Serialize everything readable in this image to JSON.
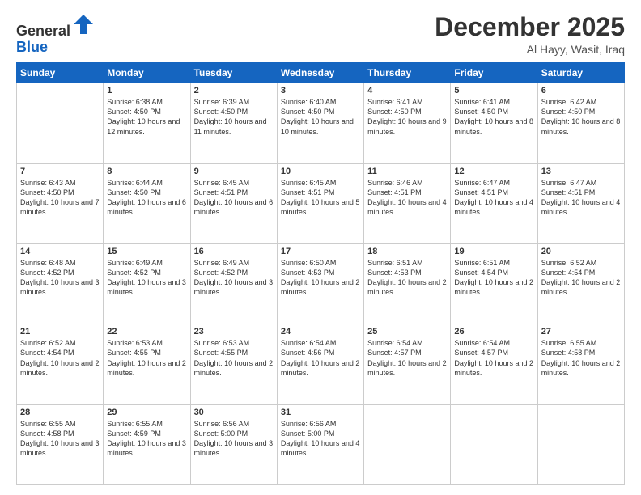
{
  "header": {
    "logo_general": "General",
    "logo_blue": "Blue",
    "month_title": "December 2025",
    "subtitle": "Al Hayy, Wasit, Iraq"
  },
  "days_of_week": [
    "Sunday",
    "Monday",
    "Tuesday",
    "Wednesday",
    "Thursday",
    "Friday",
    "Saturday"
  ],
  "weeks": [
    [
      {
        "day": "",
        "sunrise": "",
        "sunset": "",
        "daylight": ""
      },
      {
        "day": "1",
        "sunrise": "Sunrise: 6:38 AM",
        "sunset": "Sunset: 4:50 PM",
        "daylight": "Daylight: 10 hours and 12 minutes."
      },
      {
        "day": "2",
        "sunrise": "Sunrise: 6:39 AM",
        "sunset": "Sunset: 4:50 PM",
        "daylight": "Daylight: 10 hours and 11 minutes."
      },
      {
        "day": "3",
        "sunrise": "Sunrise: 6:40 AM",
        "sunset": "Sunset: 4:50 PM",
        "daylight": "Daylight: 10 hours and 10 minutes."
      },
      {
        "day": "4",
        "sunrise": "Sunrise: 6:41 AM",
        "sunset": "Sunset: 4:50 PM",
        "daylight": "Daylight: 10 hours and 9 minutes."
      },
      {
        "day": "5",
        "sunrise": "Sunrise: 6:41 AM",
        "sunset": "Sunset: 4:50 PM",
        "daylight": "Daylight: 10 hours and 8 minutes."
      },
      {
        "day": "6",
        "sunrise": "Sunrise: 6:42 AM",
        "sunset": "Sunset: 4:50 PM",
        "daylight": "Daylight: 10 hours and 8 minutes."
      }
    ],
    [
      {
        "day": "7",
        "sunrise": "Sunrise: 6:43 AM",
        "sunset": "Sunset: 4:50 PM",
        "daylight": "Daylight: 10 hours and 7 minutes."
      },
      {
        "day": "8",
        "sunrise": "Sunrise: 6:44 AM",
        "sunset": "Sunset: 4:50 PM",
        "daylight": "Daylight: 10 hours and 6 minutes."
      },
      {
        "day": "9",
        "sunrise": "Sunrise: 6:45 AM",
        "sunset": "Sunset: 4:51 PM",
        "daylight": "Daylight: 10 hours and 6 minutes."
      },
      {
        "day": "10",
        "sunrise": "Sunrise: 6:45 AM",
        "sunset": "Sunset: 4:51 PM",
        "daylight": "Daylight: 10 hours and 5 minutes."
      },
      {
        "day": "11",
        "sunrise": "Sunrise: 6:46 AM",
        "sunset": "Sunset: 4:51 PM",
        "daylight": "Daylight: 10 hours and 4 minutes."
      },
      {
        "day": "12",
        "sunrise": "Sunrise: 6:47 AM",
        "sunset": "Sunset: 4:51 PM",
        "daylight": "Daylight: 10 hours and 4 minutes."
      },
      {
        "day": "13",
        "sunrise": "Sunrise: 6:47 AM",
        "sunset": "Sunset: 4:51 PM",
        "daylight": "Daylight: 10 hours and 4 minutes."
      }
    ],
    [
      {
        "day": "14",
        "sunrise": "Sunrise: 6:48 AM",
        "sunset": "Sunset: 4:52 PM",
        "daylight": "Daylight: 10 hours and 3 minutes."
      },
      {
        "day": "15",
        "sunrise": "Sunrise: 6:49 AM",
        "sunset": "Sunset: 4:52 PM",
        "daylight": "Daylight: 10 hours and 3 minutes."
      },
      {
        "day": "16",
        "sunrise": "Sunrise: 6:49 AM",
        "sunset": "Sunset: 4:52 PM",
        "daylight": "Daylight: 10 hours and 3 minutes."
      },
      {
        "day": "17",
        "sunrise": "Sunrise: 6:50 AM",
        "sunset": "Sunset: 4:53 PM",
        "daylight": "Daylight: 10 hours and 2 minutes."
      },
      {
        "day": "18",
        "sunrise": "Sunrise: 6:51 AM",
        "sunset": "Sunset: 4:53 PM",
        "daylight": "Daylight: 10 hours and 2 minutes."
      },
      {
        "day": "19",
        "sunrise": "Sunrise: 6:51 AM",
        "sunset": "Sunset: 4:54 PM",
        "daylight": "Daylight: 10 hours and 2 minutes."
      },
      {
        "day": "20",
        "sunrise": "Sunrise: 6:52 AM",
        "sunset": "Sunset: 4:54 PM",
        "daylight": "Daylight: 10 hours and 2 minutes."
      }
    ],
    [
      {
        "day": "21",
        "sunrise": "Sunrise: 6:52 AM",
        "sunset": "Sunset: 4:54 PM",
        "daylight": "Daylight: 10 hours and 2 minutes."
      },
      {
        "day": "22",
        "sunrise": "Sunrise: 6:53 AM",
        "sunset": "Sunset: 4:55 PM",
        "daylight": "Daylight: 10 hours and 2 minutes."
      },
      {
        "day": "23",
        "sunrise": "Sunrise: 6:53 AM",
        "sunset": "Sunset: 4:55 PM",
        "daylight": "Daylight: 10 hours and 2 minutes."
      },
      {
        "day": "24",
        "sunrise": "Sunrise: 6:54 AM",
        "sunset": "Sunset: 4:56 PM",
        "daylight": "Daylight: 10 hours and 2 minutes."
      },
      {
        "day": "25",
        "sunrise": "Sunrise: 6:54 AM",
        "sunset": "Sunset: 4:57 PM",
        "daylight": "Daylight: 10 hours and 2 minutes."
      },
      {
        "day": "26",
        "sunrise": "Sunrise: 6:54 AM",
        "sunset": "Sunset: 4:57 PM",
        "daylight": "Daylight: 10 hours and 2 minutes."
      },
      {
        "day": "27",
        "sunrise": "Sunrise: 6:55 AM",
        "sunset": "Sunset: 4:58 PM",
        "daylight": "Daylight: 10 hours and 2 minutes."
      }
    ],
    [
      {
        "day": "28",
        "sunrise": "Sunrise: 6:55 AM",
        "sunset": "Sunset: 4:58 PM",
        "daylight": "Daylight: 10 hours and 3 minutes."
      },
      {
        "day": "29",
        "sunrise": "Sunrise: 6:55 AM",
        "sunset": "Sunset: 4:59 PM",
        "daylight": "Daylight: 10 hours and 3 minutes."
      },
      {
        "day": "30",
        "sunrise": "Sunrise: 6:56 AM",
        "sunset": "Sunset: 5:00 PM",
        "daylight": "Daylight: 10 hours and 3 minutes."
      },
      {
        "day": "31",
        "sunrise": "Sunrise: 6:56 AM",
        "sunset": "Sunset: 5:00 PM",
        "daylight": "Daylight: 10 hours and 4 minutes."
      },
      {
        "day": "",
        "sunrise": "",
        "sunset": "",
        "daylight": ""
      },
      {
        "day": "",
        "sunrise": "",
        "sunset": "",
        "daylight": ""
      },
      {
        "day": "",
        "sunrise": "",
        "sunset": "",
        "daylight": ""
      }
    ]
  ]
}
